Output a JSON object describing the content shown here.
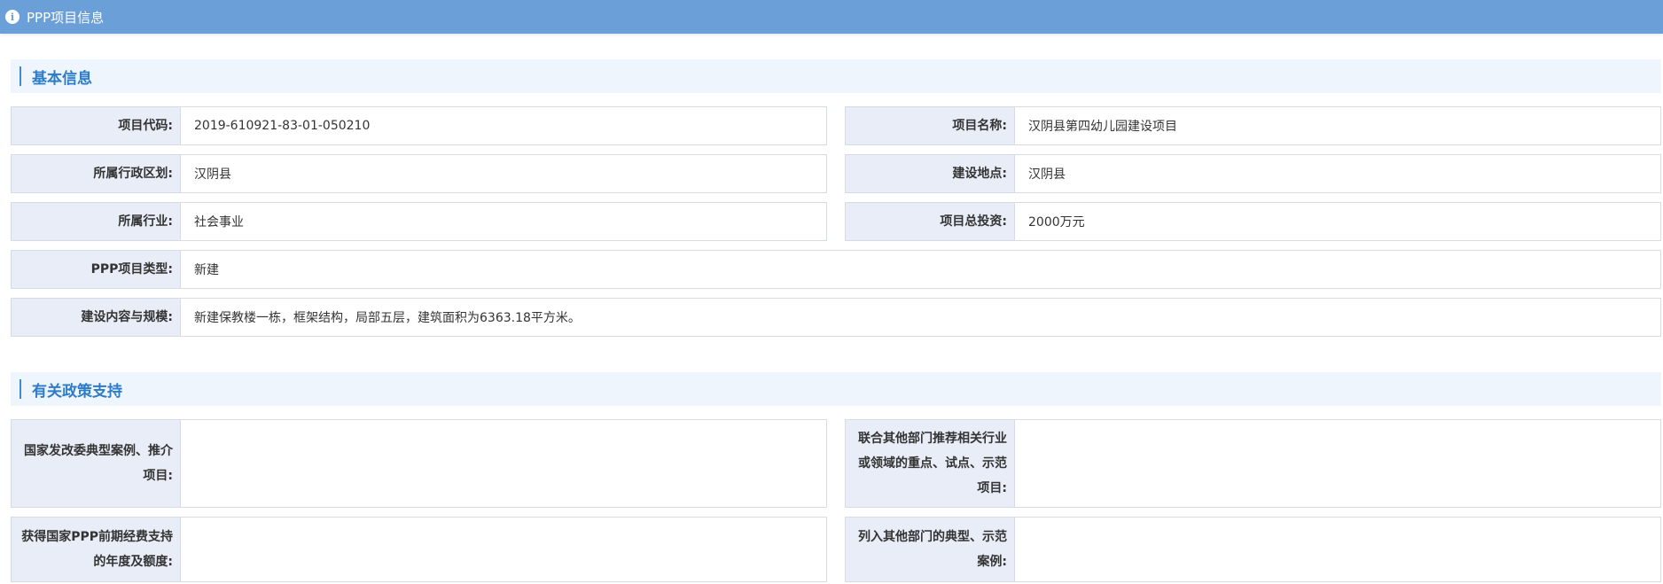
{
  "header": {
    "title": "PPP项目信息",
    "icon": "info-icon"
  },
  "sections": {
    "basic": {
      "title": "基本信息"
    },
    "policy": {
      "title": "有关政策支持"
    }
  },
  "basic_fields": {
    "project_code": {
      "label": "项目代码:",
      "value": "2019-610921-83-01-050210"
    },
    "project_name": {
      "label": "项目名称:",
      "value": "汉阴县第四幼儿园建设项目"
    },
    "admin_division": {
      "label": "所属行政区划:",
      "value": "汉阴县"
    },
    "location": {
      "label": "建设地点:",
      "value": "汉阴县"
    },
    "industry": {
      "label": "所属行业:",
      "value": "社会事业"
    },
    "total_invest": {
      "label": "项目总投资:",
      "value": "2000万元"
    },
    "ppp_type": {
      "label": "PPP项目类型:",
      "value": "新建"
    },
    "scope": {
      "label": "建设内容与规模:",
      "value": "新建保教楼一栋，框架结构，局部五层，建筑面积为6363.18平方米。"
    }
  },
  "policy_fields": {
    "ndrc_case": {
      "label": "国家发改委典型案例、推介项目:",
      "value": ""
    },
    "joint_recommend": {
      "label": "联合其他部门推荐相关行业或领域的重点、试点、示范项目:",
      "value": ""
    },
    "early_funding": {
      "label": "获得国家PPP前期经费支持的年度及额度:",
      "value": ""
    },
    "other_case": {
      "label": "列入其他部门的典型、示范案例:",
      "value": ""
    }
  }
}
